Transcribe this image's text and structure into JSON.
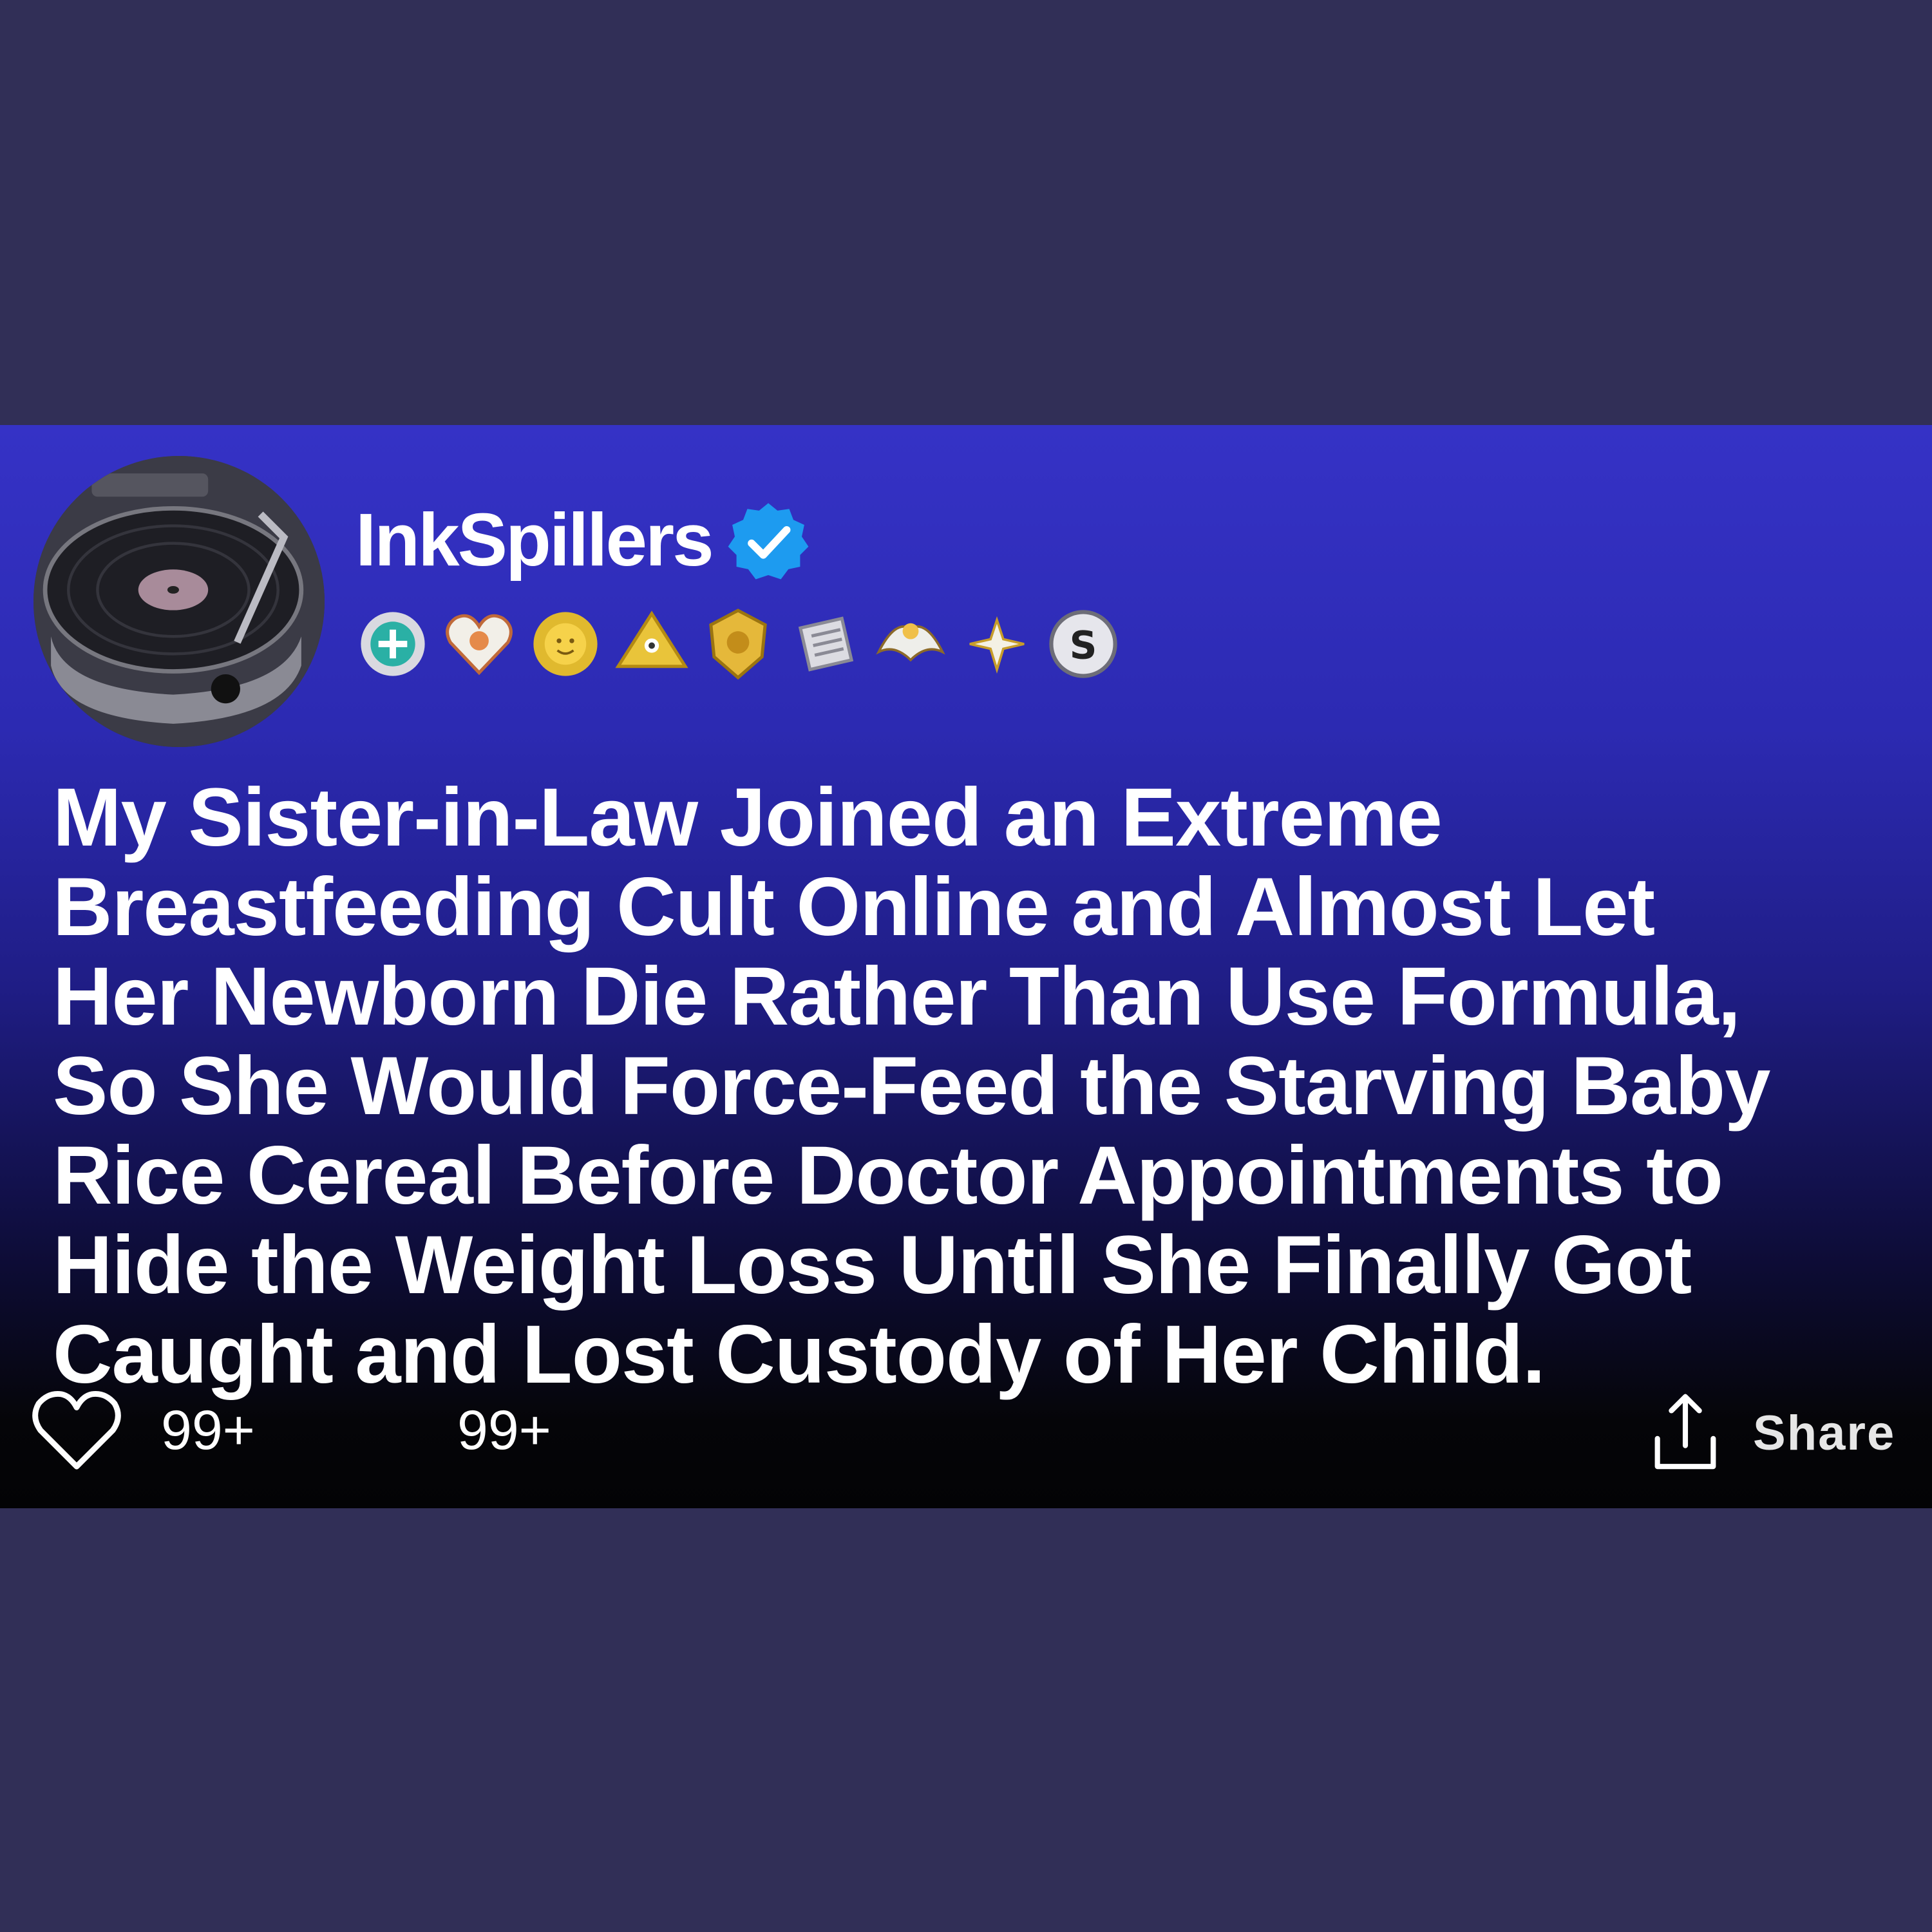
{
  "post": {
    "author": {
      "username": "InkSpillers",
      "verified": true,
      "avatar_icon": "record-player-icon"
    },
    "badges": [
      "blue-medal-icon",
      "heart-badge-icon",
      "sun-badge-icon",
      "pyramid-badge-icon",
      "gold-crest-icon",
      "scroll-badge-icon",
      "eagle-badge-icon",
      "sparkle-badge-icon",
      "s-coin-icon"
    ],
    "body_lines": [
      "My Sister-in-Law Joined an Extreme",
      "Breastfeeding Cult Online and Almost Let",
      "Her Newborn Die Rather Than Use Formula,",
      "So She Would Force-Feed the Starving Baby",
      "Rice Cereal Before Doctor Appointments to",
      "Hide the Weight Loss Until She Finally Got",
      "Caught and Lost Custody of Her Child."
    ],
    "actions": {
      "like_count": "99+",
      "comment_count": "99+",
      "share_label": "Share"
    }
  },
  "colors": {
    "page_background": "#312f57",
    "card_gradient_top": "#3532c6",
    "card_gradient_bottom": "#030305",
    "verified_blue": "#1d9bf0",
    "text": "#ffffff"
  }
}
